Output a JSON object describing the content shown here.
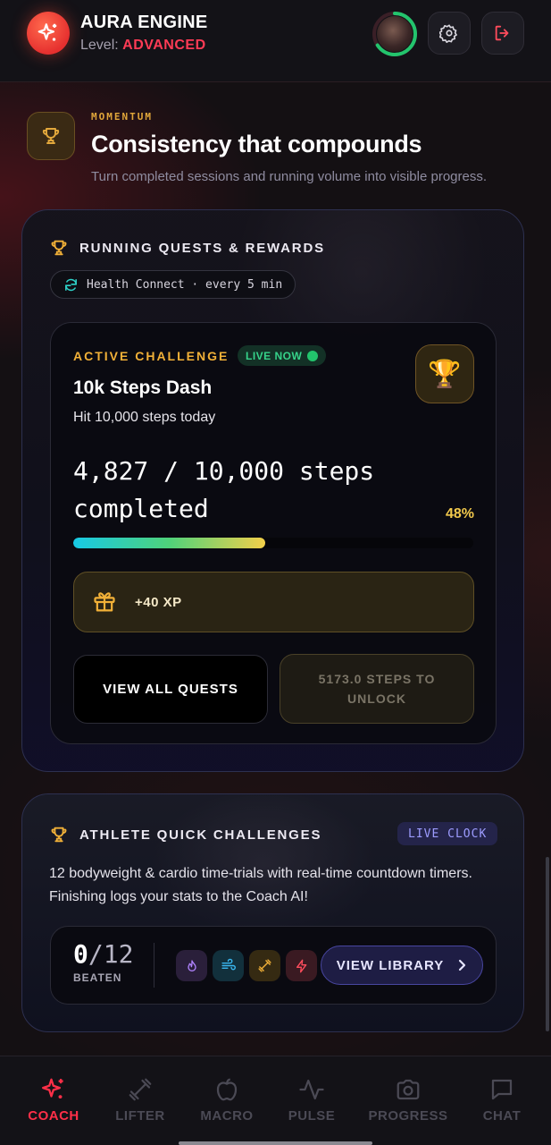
{
  "header": {
    "app_title": "AURA ENGINE",
    "level_prefix": "Level:",
    "level_value": "ADVANCED",
    "icons": [
      "sparkle-icon",
      "avatar",
      "gear-icon",
      "logout-icon"
    ]
  },
  "momentum": {
    "kicker": "MOMENTUM",
    "title": "Consistency that compounds",
    "subtitle": "Turn completed sessions and running volume into visible progress."
  },
  "quests": {
    "title": "RUNNING QUESTS & REWARDS",
    "sync_label": "Health Connect · every 5 min",
    "challenge": {
      "label": "ACTIVE CHALLENGE",
      "status": "LIVE NOW",
      "name": "10k Steps Dash",
      "description": "Hit 10,000 steps today",
      "steps_text": "4,827 / 10,000 steps completed",
      "progress_percent": 48,
      "progress_label": "48%",
      "reward": "+40 XP",
      "view_all_label": "VIEW ALL QUESTS",
      "unlock_label": "5173.0 STEPS TO UNLOCK"
    }
  },
  "athlete": {
    "title": "ATHLETE QUICK CHALLENGES",
    "badge": "LIVE CLOCK",
    "description": "12 bodyweight & cardio time-trials with real-time countdown timers. Finishing logs your stats to the Coach AI!",
    "beaten_count": "0",
    "beaten_total": "/12",
    "beaten_label": "BEATEN",
    "categories": [
      "flame-icon",
      "wind-icon",
      "dumbbell-icon",
      "bolt-icon"
    ],
    "library_label": "VIEW LIBRARY"
  },
  "nav": {
    "items": [
      {
        "label": "COACH",
        "icon": "sparkle-icon",
        "active": true
      },
      {
        "label": "LIFTER",
        "icon": "dumbbell-icon",
        "active": false
      },
      {
        "label": "MACRO",
        "icon": "apple-icon",
        "active": false
      },
      {
        "label": "PULSE",
        "icon": "pulse-icon",
        "active": false
      },
      {
        "label": "PROGRESS",
        "icon": "camera-icon",
        "active": false
      },
      {
        "label": "CHAT",
        "icon": "chat-icon",
        "active": false
      }
    ]
  },
  "colors": {
    "accent_red": "#ff2f48",
    "gold": "#f2b138",
    "live_green": "#36d38a",
    "indigo": "#9d9cff"
  }
}
